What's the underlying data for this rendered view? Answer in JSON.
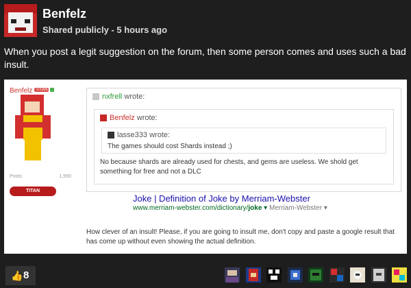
{
  "post": {
    "author": "Benfelz",
    "meta": "Shared publicly  -  5 hours ago",
    "text": "When you post a legit suggestion on the forum, then some person comes and uses such a bad insult."
  },
  "screenshot": {
    "user": {
      "name": "Benfelz",
      "rank": "TITAN",
      "posts_label": "Posts:",
      "posts_count": "1,990",
      "badge": "TITAN"
    },
    "quote_outer": {
      "author": "nxfrell",
      "wrote": "wrote:"
    },
    "quote_mid": {
      "author": "Benfelz",
      "wrote": "wrote:",
      "text": "No because shards are already used for chests, and gems are useless. We shold get something for free and not a DLC"
    },
    "quote_inner": {
      "author": "lasse333",
      "wrote": "wrote:",
      "text": "The games should cost Shards instead ;)"
    },
    "search_result": {
      "title": "Joke | Definition of Joke by Merriam-Webster",
      "url_prefix": "www.merriam-webster.com/dictionary/",
      "url_bold": "joke",
      "arrow": "▾",
      "source": "Merriam-Webster",
      "source_arrow": "▾"
    },
    "reply_text": "How clever of an insult! Please, if you are going to insult me, don't copy and paste a google result that has come up without even showing the actual definition."
  },
  "footer": {
    "plus_count": "8",
    "voters": 9
  },
  "colors": {
    "page_bg": "#1e1e1e",
    "link_blue": "#1a0dab",
    "url_green": "#006621",
    "name_red": "#c9302c",
    "name_green": "#2e9b3a"
  }
}
